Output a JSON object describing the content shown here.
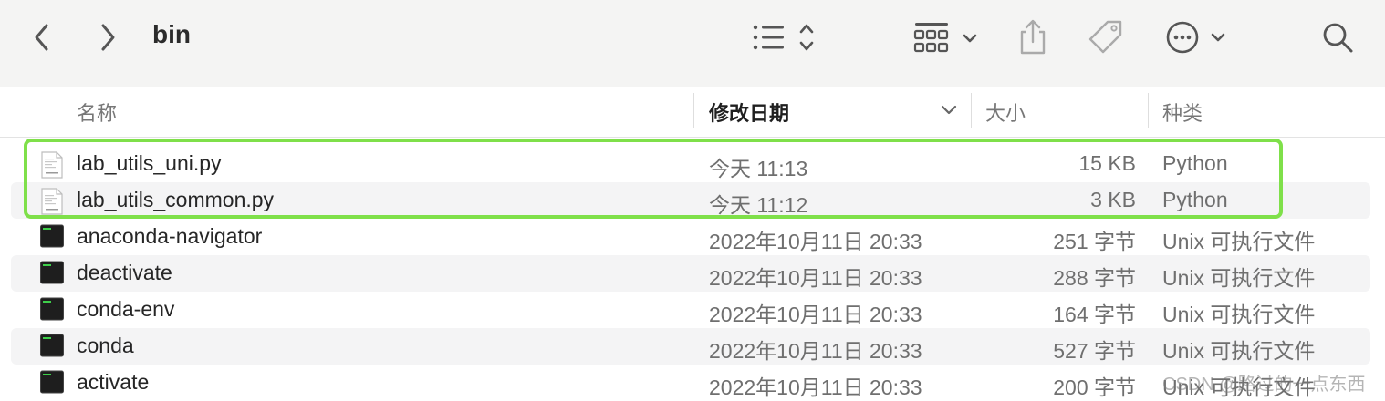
{
  "toolbar": {
    "title": "bin",
    "back_icon": "chevron-left-icon",
    "forward_icon": "chevron-right-icon",
    "view_list_icon": "list-view-icon",
    "group_icon": "grid-group-icon",
    "share_icon": "share-icon",
    "tag_icon": "tag-icon",
    "more_icon": "ellipsis-circle-icon",
    "search_icon": "search-icon"
  },
  "columns": {
    "name": "名称",
    "date": "修改日期",
    "size": "大小",
    "kind": "种类"
  },
  "files": [
    {
      "name": "lab_utils_uni.py",
      "date": "今天 11:13",
      "size": "15 KB",
      "kind": "Python",
      "icon": "python-document-icon"
    },
    {
      "name": "lab_utils_common.py",
      "date": "今天 11:12",
      "size": "3 KB",
      "kind": "Python",
      "icon": "python-document-icon"
    },
    {
      "name": "anaconda-navigator",
      "date": "2022年10月11日 20:33",
      "size": "251 字节",
      "kind": "Unix 可执行文件",
      "icon": "terminal-exec-icon"
    },
    {
      "name": "deactivate",
      "date": "2022年10月11日 20:33",
      "size": "288 字节",
      "kind": "Unix 可执行文件",
      "icon": "terminal-exec-icon"
    },
    {
      "name": "conda-env",
      "date": "2022年10月11日 20:33",
      "size": "164 字节",
      "kind": "Unix 可执行文件",
      "icon": "terminal-exec-icon"
    },
    {
      "name": "conda",
      "date": "2022年10月11日 20:33",
      "size": "527 字节",
      "kind": "Unix 可执行文件",
      "icon": "terminal-exec-icon"
    },
    {
      "name": "activate",
      "date": "2022年10月11日 20:33",
      "size": "200 字节",
      "kind": "Unix 可执行文件",
      "icon": "terminal-exec-icon"
    }
  ],
  "watermark": "CSDN @路过的一点东西",
  "colors": {
    "highlight": "#7fe04a",
    "toolbar_bg": "#f4f4f3",
    "row_alt": "#f4f4f5"
  }
}
